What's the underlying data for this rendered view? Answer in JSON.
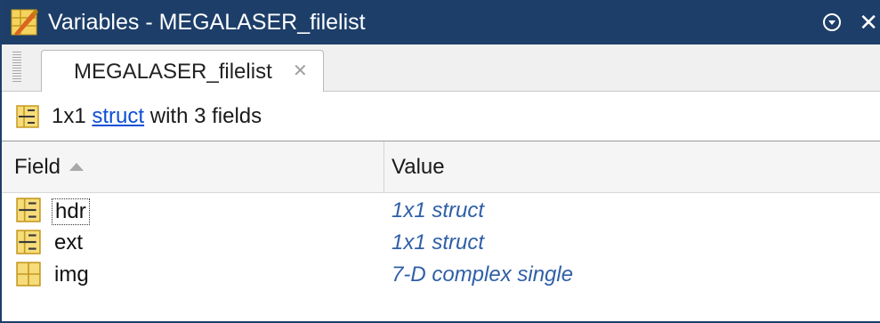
{
  "window": {
    "title": "Variables - MEGALASER_filelist",
    "close_glyph": "✕",
    "menu_icon": "circle-chevron-down-icon",
    "app_icon": "matlab-variables-icon"
  },
  "tabs": [
    {
      "label": "MEGALASER_filelist",
      "close_glyph": "✕",
      "active": true
    }
  ],
  "summary": {
    "prefix": "1x1 ",
    "link": "struct",
    "suffix": " with 3 fields",
    "icon": "struct-icon"
  },
  "table": {
    "columns": [
      {
        "label": "Field",
        "sort": "ascending"
      },
      {
        "label": "Value"
      }
    ],
    "rows": [
      {
        "name": "hdr",
        "value": "1x1 struct",
        "icon": "struct-icon",
        "focused": true
      },
      {
        "name": "ext",
        "value": "1x1 struct",
        "icon": "struct-icon",
        "focused": false
      },
      {
        "name": "img",
        "value": "7-D complex single",
        "icon": "array-icon",
        "focused": false
      }
    ]
  },
  "colors": {
    "titlebar": "#1d3e69",
    "link": "#0b4fd6",
    "value_text": "#2f5fa8",
    "icon_fill": "#f6dc7a",
    "icon_border": "#c59a20"
  }
}
